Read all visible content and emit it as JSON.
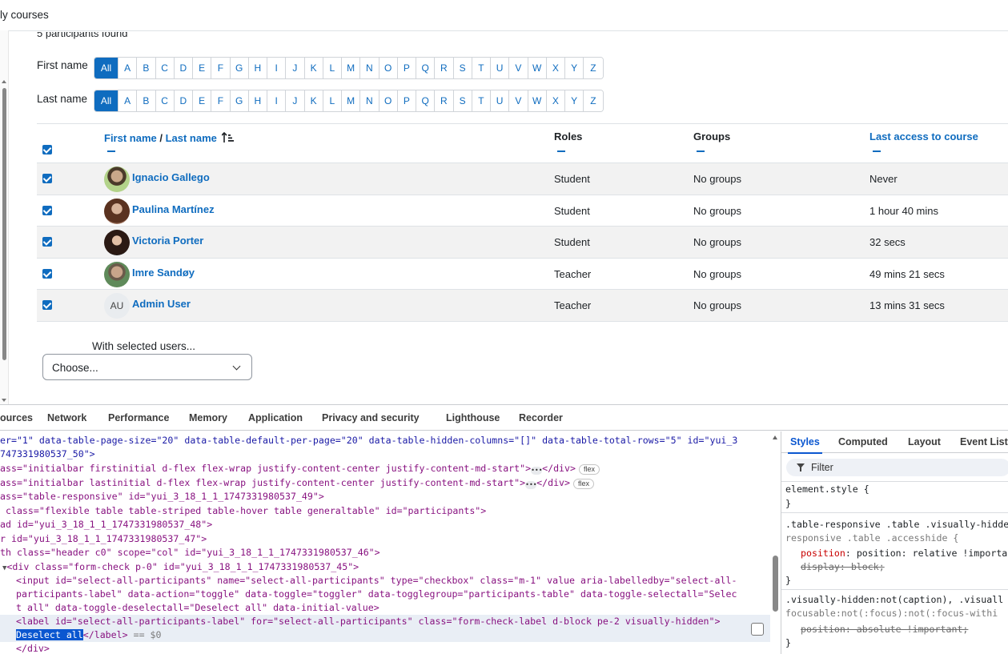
{
  "breadcrumb": "ly courses",
  "found_text": "5 participants found",
  "filters": {
    "first_name_label": "First name",
    "last_name_label": "Last name",
    "all_label": "All",
    "letters": [
      "A",
      "B",
      "C",
      "D",
      "E",
      "F",
      "G",
      "H",
      "I",
      "J",
      "K",
      "L",
      "M",
      "N",
      "O",
      "P",
      "Q",
      "R",
      "S",
      "T",
      "U",
      "V",
      "W",
      "X",
      "Y",
      "Z"
    ]
  },
  "table": {
    "headers": {
      "first_name": "First name",
      "separator": " / ",
      "last_name": "Last name",
      "roles": "Roles",
      "groups": "Groups",
      "last_access": "Last access to course"
    },
    "rows": [
      {
        "name": "Ignacio Gallego",
        "role": "Student",
        "groups": "No groups",
        "access": "Never",
        "avatar": "photo"
      },
      {
        "name": "Paulina Martínez",
        "role": "Student",
        "groups": "No groups",
        "access": "1 hour 40 mins",
        "avatar": "photo"
      },
      {
        "name": "Victoria Porter",
        "role": "Student",
        "groups": "No groups",
        "access": "32 secs",
        "avatar": "photo"
      },
      {
        "name": "Imre Sandøy",
        "role": "Teacher",
        "groups": "No groups",
        "access": "49 mins 21 secs",
        "avatar": "photo"
      },
      {
        "name": "Admin User",
        "role": "Teacher",
        "groups": "No groups",
        "access": "13 mins 31 secs",
        "avatar": "AU"
      }
    ]
  },
  "bulk": {
    "label": "With selected users...",
    "select_value": "Choose..."
  },
  "devtools": {
    "tabs": [
      "ources",
      "Network",
      "Performance",
      "Memory",
      "Application",
      "Privacy and security",
      "Lighthouse",
      "Recorder"
    ],
    "style_tabs": [
      "Styles",
      "Computed",
      "Layout",
      "Event List"
    ],
    "filter_placeholder": "Filter",
    "dom_lines": [
      "er=\"1\" data-table-page-size=\"20\" data-table-default-per-page=\"20\" data-table-hidden-columns=\"[]\" data-table-total-rows=\"5\" id=\"yui_3",
      "747331980537_50\">",
      "ass=\"initialbar firstinitial d-flex flex-wrap justify-content-center justify-content-md-start\">",
      "ass=\"initialbar lastinitial d-flex flex-wrap justify-content-center justify-content-md-start\">",
      "ass=\"table-responsive\" id=\"yui_3_18_1_1_1747331980537_49\">",
      " class=\"flexible table table-striped table-hover table generaltable\" id=\"participants\">",
      "ad id=\"yui_3_18_1_1_1747331980537_48\">",
      "r id=\"yui_3_18_1_1_1747331980537_47\">",
      "th class=\"header c0\" scope=\"col\" id=\"yui_3_18_1_1_1747331980537_46\">",
      "<div class=\"form-check p-0\" id=\"yui_3_18_1_1_1747331980537_45\">",
      "<input id=\"select-all-participants\" name=\"select-all-participants\" type=\"checkbox\" class=\"m-1\" value aria-labelledby=\"select-all-",
      "participants-label\" data-action=\"toggle\" data-toggle=\"toggler\" data-togglegroup=\"participants-table\" data-toggle-selectall=\"Selec",
      "t all\" data-toggle-deselectall=\"Deselect all\" data-initial-value>",
      "<label id=\"select-all-participants-label\" for=\"select-all-participants\" class=\"form-check-label d-block pe-2 visually-hidden\">",
      "Deselect all",
      "</div>"
    ],
    "flex_badge": "flex",
    "dollar_zero": " == $0",
    "styles_lines": {
      "element_style": "element.style {",
      "close": "}",
      "rule1_sel_a": ".table-responsive .table .visually-hidde",
      "rule1_sel_b": "responsive .table .accesshide {",
      "rule1_p1": "position: relative !important;",
      "rule1_p2": "display: block;",
      "rule2_sel_a": ".visually-hidden:not(caption), .visuall",
      "rule2_sel_b": "focusable:not(:focus):not(:focus-withi",
      "rule2_p1": "position: absolute !important;"
    }
  }
}
